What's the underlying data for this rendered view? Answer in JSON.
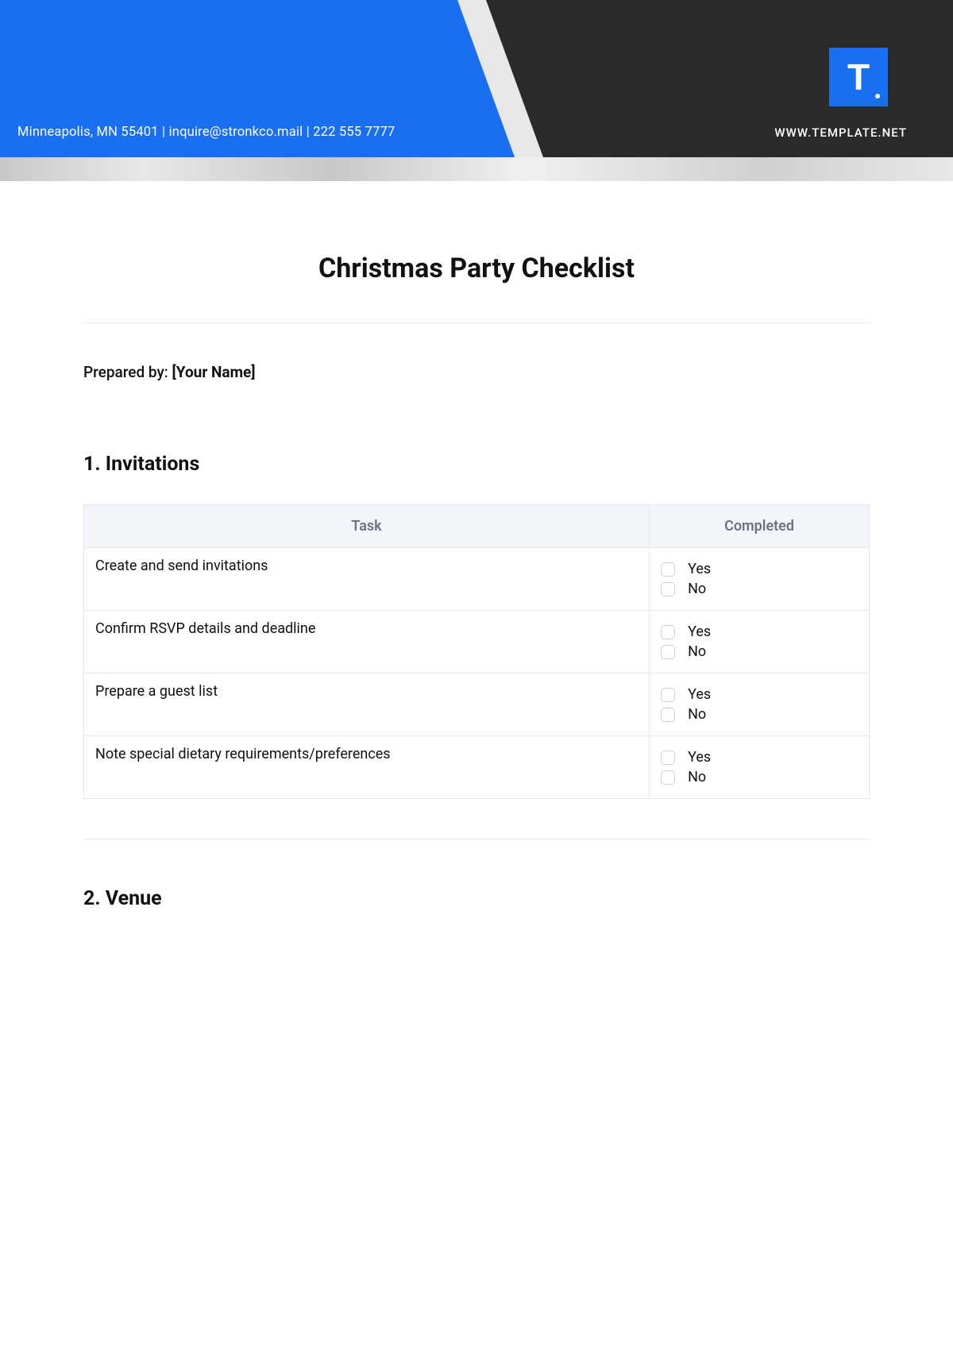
{
  "header": {
    "address": "Minneapolis, MN 55401 | inquire@stronkco.mail | 222 555 7777",
    "website": "WWW.TEMPLATE.NET",
    "logo_text": "T"
  },
  "title": "Christmas Party Checklist",
  "prepared_by_label": "Prepared by: ",
  "prepared_by_value": "[Your Name]",
  "table_headers": {
    "task": "Task",
    "completed": "Completed"
  },
  "check_options": {
    "yes": "Yes",
    "no": "No"
  },
  "sections": [
    {
      "heading": "1. Invitations",
      "tasks": [
        "Create and send invitations",
        "Confirm RSVP details and deadline",
        "Prepare a guest list",
        "Note special dietary requirements/preferences"
      ]
    },
    {
      "heading": "2. Venue",
      "tasks": []
    }
  ]
}
